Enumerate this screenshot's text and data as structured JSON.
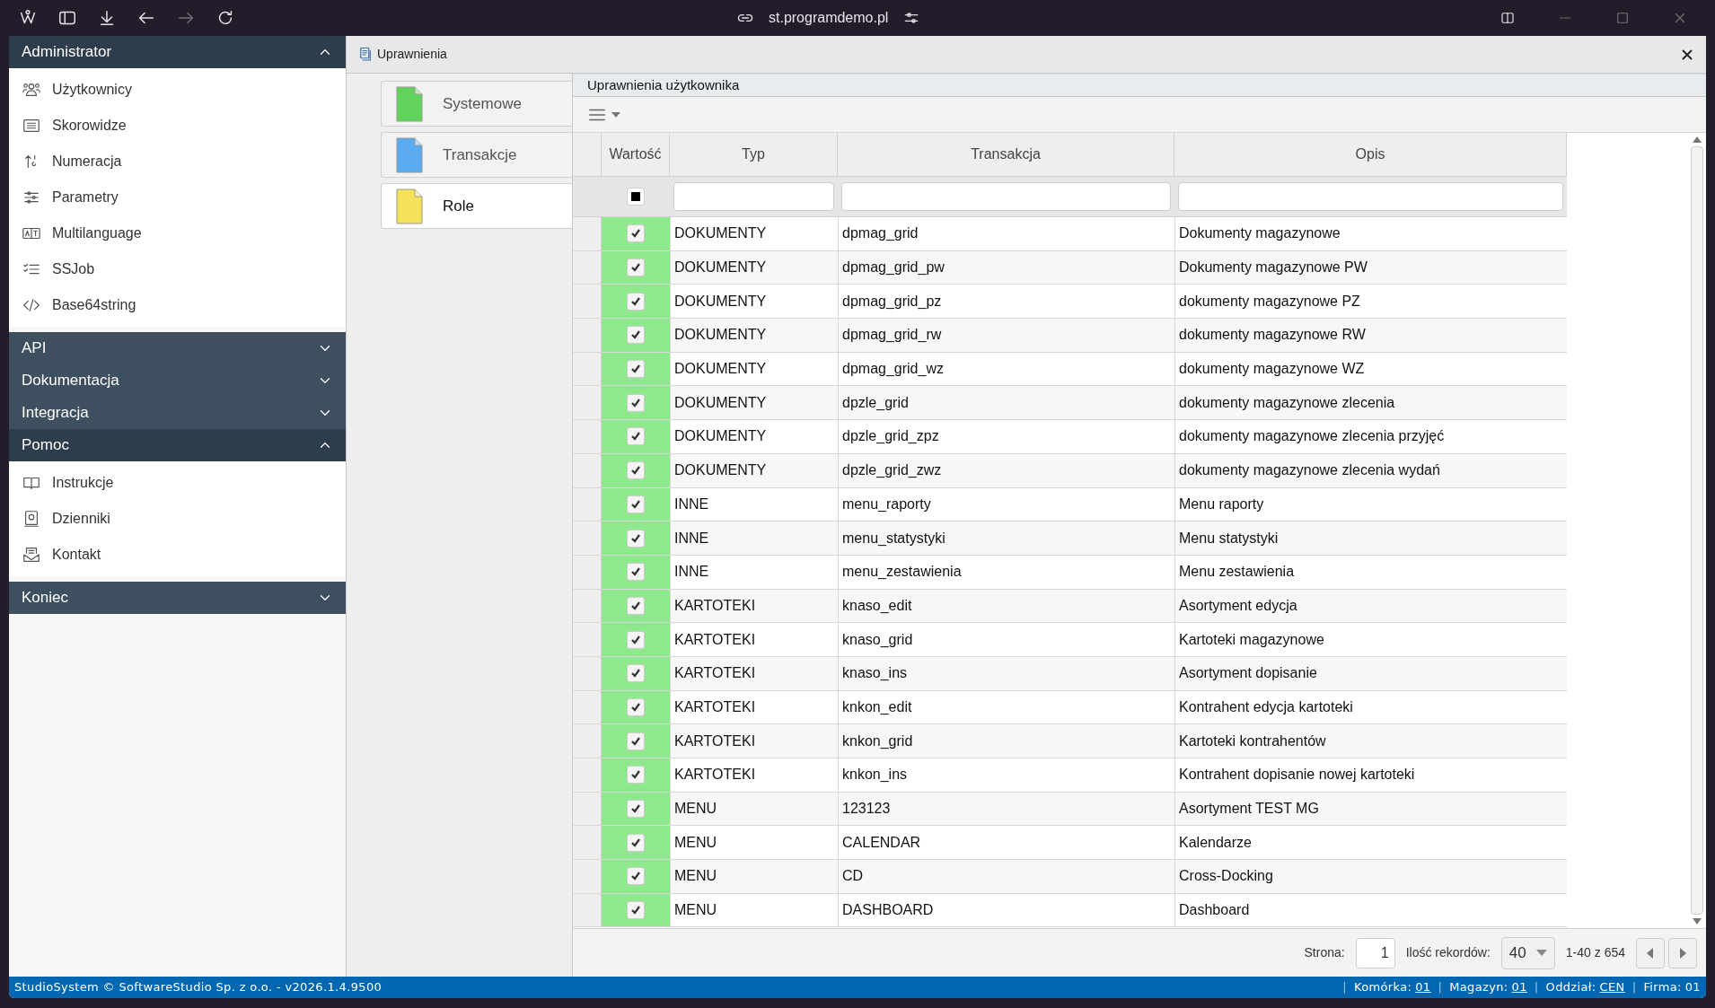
{
  "browser": {
    "url": "st.programdemo.pl"
  },
  "sidebar": {
    "sections": [
      {
        "title": "Administrator",
        "expanded": true,
        "items": [
          "Użytkownicy",
          "Skorowidze",
          "Numeracja",
          "Parametry",
          "Multilanguage",
          "SSJob",
          "Base64string"
        ]
      },
      {
        "title": "API",
        "expanded": false
      },
      {
        "title": "Dokumentacja",
        "expanded": false
      },
      {
        "title": "Integracja",
        "expanded": false
      },
      {
        "title": "Pomoc",
        "expanded": true,
        "items": [
          "Instrukcje",
          "Dzienniki",
          "Kontakt"
        ]
      },
      {
        "title": "Koniec",
        "expanded": false
      }
    ]
  },
  "window": {
    "title": "Uprawnienia"
  },
  "tabs": [
    {
      "label": "Systemowe",
      "selected": false,
      "color": "#5fd35a"
    },
    {
      "label": "Transakcje",
      "selected": false,
      "color": "#5aaaf0"
    },
    {
      "label": "Role",
      "selected": true,
      "color": "#f5e25a"
    }
  ],
  "grid": {
    "title": "Uprawnienia użytkownika",
    "columns": [
      "Wartość",
      "Typ",
      "Transakcja",
      "Opis"
    ],
    "select_all": {
      "indeterminate": true
    },
    "rows": [
      {
        "checked": true,
        "typ": "DOKUMENTY",
        "transakcja": "dpmag_grid",
        "opis": "Dokumenty magazynowe"
      },
      {
        "checked": true,
        "typ": "DOKUMENTY",
        "transakcja": "dpmag_grid_pw",
        "opis": "Dokumenty magazynowe PW"
      },
      {
        "checked": true,
        "typ": "DOKUMENTY",
        "transakcja": "dpmag_grid_pz",
        "opis": "dokumenty magazynowe PZ"
      },
      {
        "checked": true,
        "typ": "DOKUMENTY",
        "transakcja": "dpmag_grid_rw",
        "opis": "dokumenty magazynowe RW"
      },
      {
        "checked": true,
        "typ": "DOKUMENTY",
        "transakcja": "dpmag_grid_wz",
        "opis": "dokumenty magazynowe WZ"
      },
      {
        "checked": true,
        "typ": "DOKUMENTY",
        "transakcja": "dpzle_grid",
        "opis": "dokumenty magazynowe zlecenia"
      },
      {
        "checked": true,
        "typ": "DOKUMENTY",
        "transakcja": "dpzle_grid_zpz",
        "opis": "dokumenty magazynowe zlecenia przyjęć"
      },
      {
        "checked": true,
        "typ": "DOKUMENTY",
        "transakcja": "dpzle_grid_zwz",
        "opis": "dokumenty magazynowe zlecenia wydań"
      },
      {
        "checked": true,
        "typ": "INNE",
        "transakcja": "menu_raporty",
        "opis": "Menu raporty"
      },
      {
        "checked": true,
        "typ": "INNE",
        "transakcja": "menu_statystyki",
        "opis": "Menu statystyki"
      },
      {
        "checked": true,
        "typ": "INNE",
        "transakcja": "menu_zestawienia",
        "opis": "Menu zestawienia"
      },
      {
        "checked": true,
        "typ": "KARTOTEKI",
        "transakcja": "knaso_edit",
        "opis": "Asortyment edycja"
      },
      {
        "checked": true,
        "typ": "KARTOTEKI",
        "transakcja": "knaso_grid",
        "opis": "Kartoteki magazynowe"
      },
      {
        "checked": true,
        "typ": "KARTOTEKI",
        "transakcja": "knaso_ins",
        "opis": "Asortyment dopisanie"
      },
      {
        "checked": true,
        "typ": "KARTOTEKI",
        "transakcja": "knkon_edit",
        "opis": "Kontrahent edycja kartoteki"
      },
      {
        "checked": true,
        "typ": "KARTOTEKI",
        "transakcja": "knkon_grid",
        "opis": "Kartoteki kontrahentów"
      },
      {
        "checked": true,
        "typ": "KARTOTEKI",
        "transakcja": "knkon_ins",
        "opis": "Kontrahent dopisanie nowej kartoteki"
      },
      {
        "checked": true,
        "typ": "MENU",
        "transakcja": "123123",
        "opis": "Asortyment TEST MG"
      },
      {
        "checked": true,
        "typ": "MENU",
        "transakcja": "CALENDAR",
        "opis": "Kalendarze"
      },
      {
        "checked": true,
        "typ": "MENU",
        "transakcja": "CD",
        "opis": "Cross-Docking"
      },
      {
        "checked": true,
        "typ": "MENU",
        "transakcja": "DASHBOARD",
        "opis": "Dashboard"
      }
    ],
    "pager": {
      "page_label": "Strona:",
      "page": "1",
      "size_label": "Ilość rekordów:",
      "size": "40",
      "range": "1-40 z 654"
    }
  },
  "status_bar": {
    "left": "StudioSystem © SoftwareStudio Sp. z o.o. - v2026.1.4.9500",
    "fields": [
      {
        "separator": "|",
        "label": "Komórka:",
        "value": "01",
        "link": true
      },
      {
        "separator": "|",
        "label": "Magazyn:",
        "value": "01",
        "link": true
      },
      {
        "separator": "|",
        "label": "Oddział:",
        "value": "CEN",
        "link": true
      },
      {
        "separator": "|",
        "label": "Firma:",
        "value": "01",
        "link": false
      }
    ]
  }
}
